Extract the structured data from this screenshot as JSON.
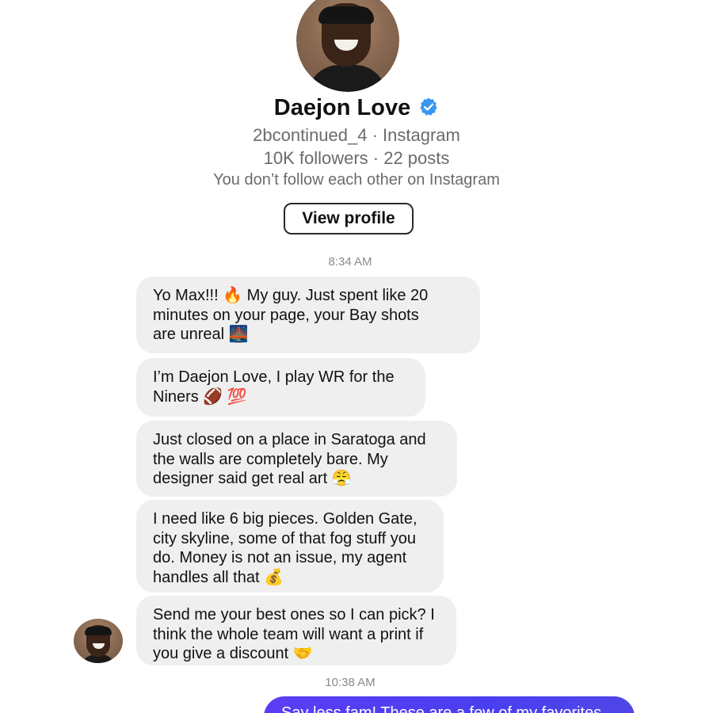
{
  "profile": {
    "name": "Daejon Love",
    "verified": true,
    "handle_line": "2bcontinued_4 · Instagram",
    "stats_line": "10K followers · 22 posts",
    "follow_note": "You don’t follow each other on Instagram",
    "view_profile_label": "View profile",
    "avatar_icon": "profile-photo",
    "verified_icon": "verified-badge-icon"
  },
  "colors": {
    "verified_blue": "#3897f0",
    "incoming_bubble": "#efefef",
    "outgoing_bubble": "#4a3ff0"
  },
  "thread": {
    "timestamp_1": "8:34 AM",
    "timestamp_2": "10:38 AM",
    "incoming": [
      {
        "text": "Yo Max!!! 🔥  My guy. Just spent like 20\nminutes on your page, your Bay shots\nare unreal 🌉"
      },
      {
        "text": "I’m Daejon Love, I play WR for the\nNiners  🏈 💯"
      },
      {
        "text": "Just closed on a place in Saratoga and\nthe walls are completely bare. My\ndesigner said get real art 😤"
      },
      {
        "text": "I need like 6 big pieces. Golden Gate,\ncity skyline, some of that fog stuff you\ndo. Money is not an issue, my agent\nhandles all that 💰"
      },
      {
        "text": "Send me your best ones so I can pick? I\nthink the whole team will want a print if\nyou give a discount 🤝"
      }
    ],
    "outgoing": [
      {
        "text": "Say less fam! These are a few of my favorites"
      }
    ]
  }
}
